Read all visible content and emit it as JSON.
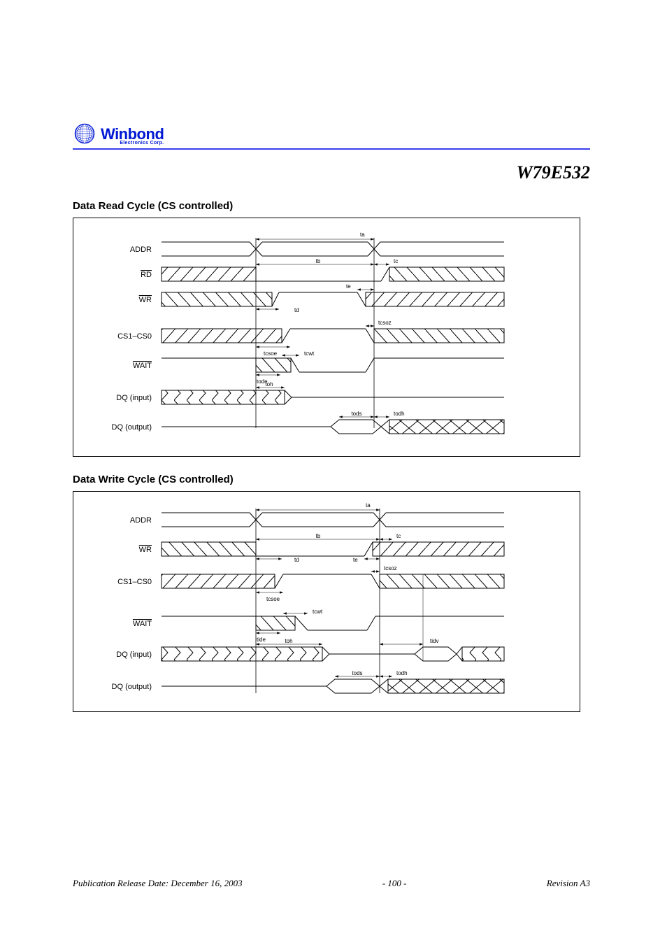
{
  "brand": {
    "name": "Winbond",
    "sub": "Electronics Corp."
  },
  "part_number": "W79E532",
  "section_read": {
    "title": "Data Read Cycle (CS controlled)",
    "cs_over": "CS"
  },
  "section_write": {
    "title": "Data Write Cycle (CS controlled)",
    "cs_over": "CS"
  },
  "signals_read": {
    "addr": "ADDR",
    "rd": "RD",
    "wr": "WR",
    "cs1": "CS1–CS0",
    "wait": "WAIT",
    "dq_in": "DQ (input)",
    "dq_out": "DQ (output)"
  },
  "signals_write": {
    "addr": "ADDR",
    "wr": "WR",
    "cs1": "CS1–CS0",
    "wait": "WAIT",
    "dq_in": "DQ (input)",
    "dq_out": "DQ (output)"
  },
  "timing_read": {
    "ta": "ta",
    "tb": "tb",
    "tc": "tc",
    "td": "td",
    "te": "te",
    "tcsoe": "tcsoe",
    "tode": "tode",
    "tcwt": "tcwt",
    "tcsoz": "tcsoz",
    "toh": "toh",
    "tods": "tods",
    "todh": "todh"
  },
  "timing_write": {
    "ta": "ta",
    "tb": "tb",
    "tc": "tc",
    "td": "td",
    "te": "te",
    "tcsoe": "tcsoe",
    "tide": "tide",
    "tcwt": "tcwt",
    "tcsoz": "tcsoz",
    "tods": "tods",
    "todh": "todh",
    "tidv": "tidv",
    "toh": "toh"
  },
  "footer": {
    "left": "Publication Release Date: December 16, 2003",
    "page": "- 100 -",
    "right": "Revision A3"
  },
  "chart_data": [
    {
      "type": "timing-diagram",
      "title": "Data Read Cycle (CS controlled)",
      "signals": [
        {
          "name": "ADDR",
          "events": [
            {
              "t": 0.3,
              "kind": "transition",
              "from": "valid",
              "to": "valid"
            },
            {
              "t": 0.56,
              "kind": "transition",
              "from": "valid",
              "to": "valid"
            }
          ]
        },
        {
          "name": "RD",
          "events": [
            {
              "t": 0.0,
              "level": "dontcare"
            },
            {
              "t": 0.3,
              "level": "low"
            },
            {
              "t": 0.575,
              "level": "dontcare"
            }
          ]
        },
        {
          "name": "WR",
          "events": [
            {
              "t": 0.0,
              "level": "dontcare"
            },
            {
              "t": 0.32,
              "level": "high"
            },
            {
              "t": 0.545,
              "level": "dontcare"
            }
          ]
        },
        {
          "name": "CS1-CS0",
          "events": [
            {
              "t": 0.0,
              "level": "dontcare"
            },
            {
              "t": 0.33,
              "level": "high"
            },
            {
              "t": 0.56,
              "level": "dontcare"
            }
          ]
        },
        {
          "name": "WAIT",
          "events": [
            {
              "t": 0.0,
              "level": "high"
            },
            {
              "t": 0.34,
              "level": "dontcare"
            },
            {
              "t": 0.38,
              "level": "low"
            },
            {
              "t": 0.55,
              "level": "high"
            }
          ]
        },
        {
          "name": "DQ (input)",
          "events": [
            {
              "t": 0.0,
              "level": "data"
            },
            {
              "t": 0.34,
              "level": "float"
            }
          ]
        },
        {
          "name": "DQ (output)",
          "events": [
            {
              "t": 0.0,
              "level": "float"
            },
            {
              "t": 0.49,
              "level": "data"
            },
            {
              "t": 0.57,
              "level": "transition"
            },
            {
              "t": 0.61,
              "level": "data-burst"
            }
          ]
        }
      ],
      "intervals": [
        {
          "name": "ta",
          "from_signal": "ADDR",
          "t0": 0.3,
          "t1": 0.56
        },
        {
          "name": "tb",
          "from_signal": "RD",
          "t0": 0.3,
          "t1": 0.56
        },
        {
          "name": "tc",
          "from_signal": "RD",
          "t0": 0.56,
          "t1": 0.575
        },
        {
          "name": "td",
          "from_signal": "WR",
          "t0": 0.3,
          "t1": 0.32
        },
        {
          "name": "te",
          "from_signal": "WR",
          "t0": 0.545,
          "t1": 0.56
        },
        {
          "name": "tcsoe",
          "from_signal": "CS",
          "t0": 0.3,
          "t1": 0.33
        },
        {
          "name": "tcsoz",
          "from_signal": "CS",
          "t0": 0.545,
          "t1": 0.56
        },
        {
          "name": "tode",
          "from_signal": "WAIT",
          "t0": 0.3,
          "t1": 0.34
        },
        {
          "name": "tcwt",
          "from_signal": "WAIT",
          "t0": 0.33,
          "t1": 0.38
        },
        {
          "name": "toh",
          "from_signal": "DQ(in)",
          "t0": 0.3,
          "t1": 0.34
        },
        {
          "name": "tods",
          "from_signal": "DQ(out)",
          "t0": 0.49,
          "t1": 0.56
        },
        {
          "name": "todh",
          "from_signal": "DQ(out)",
          "t0": 0.56,
          "t1": 0.575
        }
      ]
    },
    {
      "type": "timing-diagram",
      "title": "Data Write Cycle (CS controlled)",
      "signals": [
        {
          "name": "ADDR",
          "events": [
            {
              "t": 0.31,
              "kind": "transition"
            },
            {
              "t": 0.585,
              "kind": "transition"
            }
          ]
        },
        {
          "name": "WR",
          "events": [
            {
              "t": 0.0,
              "level": "dontcare"
            },
            {
              "t": 0.31,
              "level": "low"
            },
            {
              "t": 0.56,
              "level": "dontcare"
            }
          ]
        },
        {
          "name": "CS1-CS0",
          "events": [
            {
              "t": 0.0,
              "level": "dontcare"
            },
            {
              "t": 0.335,
              "level": "high"
            },
            {
              "t": 0.585,
              "level": "dontcare"
            }
          ]
        },
        {
          "name": "WAIT",
          "events": [
            {
              "t": 0.0,
              "level": "high"
            },
            {
              "t": 0.345,
              "level": "dontcare"
            },
            {
              "t": 0.4,
              "level": "low"
            },
            {
              "t": 0.56,
              "level": "high"
            }
          ]
        },
        {
          "name": "DQ (input)",
          "events": [
            {
              "t": 0.0,
              "level": "data"
            },
            {
              "t": 0.41,
              "level": "float"
            },
            {
              "t": 0.63,
              "level": "data"
            },
            {
              "t": 0.695,
              "level": "float"
            },
            {
              "t": 0.7,
              "level": "data-burst"
            }
          ]
        },
        {
          "name": "DQ (output)",
          "events": [
            {
              "t": 0.0,
              "level": "float"
            },
            {
              "t": 0.49,
              "level": "data"
            },
            {
              "t": 0.575,
              "level": "transition"
            },
            {
              "t": 0.605,
              "level": "data-burst"
            }
          ]
        }
      ],
      "intervals": [
        {
          "name": "ta",
          "t0": 0.31,
          "t1": 0.585
        },
        {
          "name": "tb",
          "t0": 0.31,
          "t1": 0.585
        },
        {
          "name": "tc",
          "t0": 0.585,
          "t1": 0.6
        },
        {
          "name": "td",
          "t0": 0.31,
          "t1": 0.355
        },
        {
          "name": "te",
          "t0": 0.555,
          "t1": 0.585
        },
        {
          "name": "tcsoe",
          "t0": 0.31,
          "t1": 0.335
        },
        {
          "name": "tcsoz",
          "t0": 0.555,
          "t1": 0.585
        },
        {
          "name": "tide",
          "t0": 0.31,
          "t1": 0.345
        },
        {
          "name": "tcwt",
          "t0": 0.335,
          "t1": 0.4
        },
        {
          "name": "toh",
          "t0": 0.31,
          "t1": 0.41
        },
        {
          "name": "tidv",
          "t0": 0.585,
          "t1": 0.63
        },
        {
          "name": "tods",
          "t0": 0.49,
          "t1": 0.585
        },
        {
          "name": "todh",
          "t0": 0.585,
          "t1": 0.6
        }
      ]
    }
  ]
}
